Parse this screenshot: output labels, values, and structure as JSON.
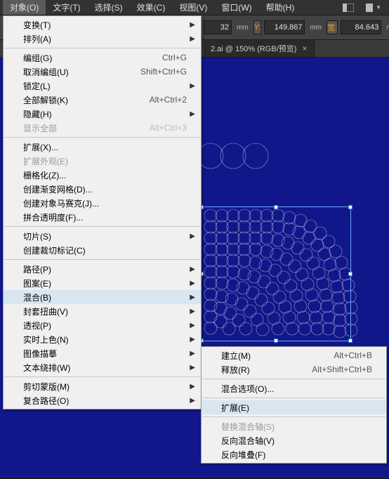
{
  "menubar": {
    "items": [
      {
        "label": "对象(O)"
      },
      {
        "label": "文字(T)"
      },
      {
        "label": "选择(S)"
      },
      {
        "label": "效果(C)"
      },
      {
        "label": "视图(V)"
      },
      {
        "label": "窗口(W)"
      },
      {
        "label": "帮助(H)"
      }
    ]
  },
  "toolbar": {
    "x_suffix": "32",
    "x_unit": "mm",
    "y_label": "Y:",
    "y_value": "149.867",
    "y_unit": "mm",
    "w_label": "宽:",
    "w_value": "84.643",
    "w_unit": "mm"
  },
  "tab": {
    "title": "2.ai @ 150% (RGB/预览)",
    "close": "×"
  },
  "menu": {
    "groups": [
      [
        {
          "label": "变换(T)",
          "arrow": true
        },
        {
          "label": "排列(A)",
          "arrow": true
        }
      ],
      [
        {
          "label": "编组(G)",
          "shortcut": "Ctrl+G"
        },
        {
          "label": "取消编组(U)",
          "shortcut": "Shift+Ctrl+G"
        },
        {
          "label": "锁定(L)",
          "arrow": true
        },
        {
          "label": "全部解锁(K)",
          "shortcut": "Alt+Ctrl+2"
        },
        {
          "label": "隐藏(H)",
          "arrow": true
        },
        {
          "label": "显示全部",
          "shortcut": "Alt+Ctrl+3",
          "disabled": true
        }
      ],
      [
        {
          "label": "扩展(X)..."
        },
        {
          "label": "扩展外观(E)",
          "disabled": true
        },
        {
          "label": "栅格化(Z)..."
        },
        {
          "label": "创建渐变网格(D)..."
        },
        {
          "label": "创建对象马赛克(J)..."
        },
        {
          "label": "拼合透明度(F)..."
        }
      ],
      [
        {
          "label": "切片(S)",
          "arrow": true
        },
        {
          "label": "创建裁切标记(C)"
        }
      ],
      [
        {
          "label": "路径(P)",
          "arrow": true
        },
        {
          "label": "图案(E)",
          "arrow": true
        },
        {
          "label": "混合(B)",
          "arrow": true,
          "highlight": true
        },
        {
          "label": "封套扭曲(V)",
          "arrow": true
        },
        {
          "label": "透视(P)",
          "arrow": true
        },
        {
          "label": "实时上色(N)",
          "arrow": true
        },
        {
          "label": "图像描摹",
          "arrow": true
        },
        {
          "label": "文本绕排(W)",
          "arrow": true
        }
      ],
      [
        {
          "label": "剪切蒙版(M)",
          "arrow": true
        },
        {
          "label": "复合路径(O)",
          "arrow": true
        }
      ]
    ]
  },
  "submenu": {
    "groups": [
      [
        {
          "label": "建立(M)",
          "shortcut": "Alt+Ctrl+B"
        },
        {
          "label": "释放(R)",
          "shortcut": "Alt+Shift+Ctrl+B"
        }
      ],
      [
        {
          "label": "混合选项(O)..."
        }
      ],
      [
        {
          "label": "扩展(E)",
          "highlight": true
        }
      ],
      [
        {
          "label": "替换混合轴(S)",
          "disabled": true
        },
        {
          "label": "反向混合轴(V)"
        },
        {
          "label": "反向堆叠(F)"
        }
      ]
    ]
  }
}
